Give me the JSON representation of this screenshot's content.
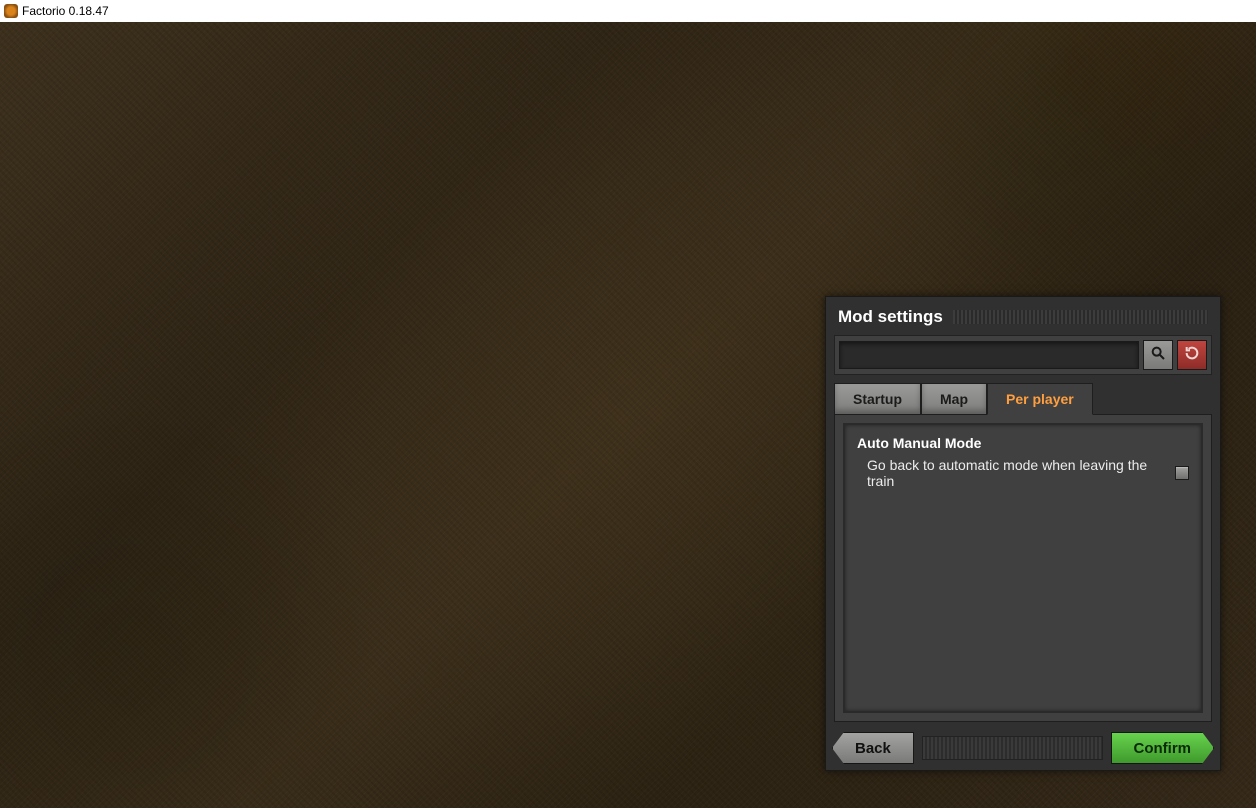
{
  "window": {
    "title": "Factorio 0.18.47"
  },
  "dialog": {
    "title": "Mod settings",
    "search": {
      "value": "",
      "placeholder": ""
    },
    "tabs": [
      {
        "label": "Startup",
        "active": false
      },
      {
        "label": "Map",
        "active": false
      },
      {
        "label": "Per player",
        "active": true
      }
    ],
    "sections": [
      {
        "heading": "Auto Manual Mode",
        "settings": [
          {
            "label": "Go back to automatic mode when leaving the train",
            "checked": false
          }
        ]
      }
    ],
    "buttons": {
      "back": "Back",
      "confirm": "Confirm"
    }
  },
  "icons": {
    "search": "search-icon",
    "reset": "reset-icon"
  },
  "colors": {
    "accent_orange": "#ff9f3f",
    "confirm_green": "#5ec148",
    "reset_red": "#a8372f",
    "panel_grey": "#313031"
  }
}
